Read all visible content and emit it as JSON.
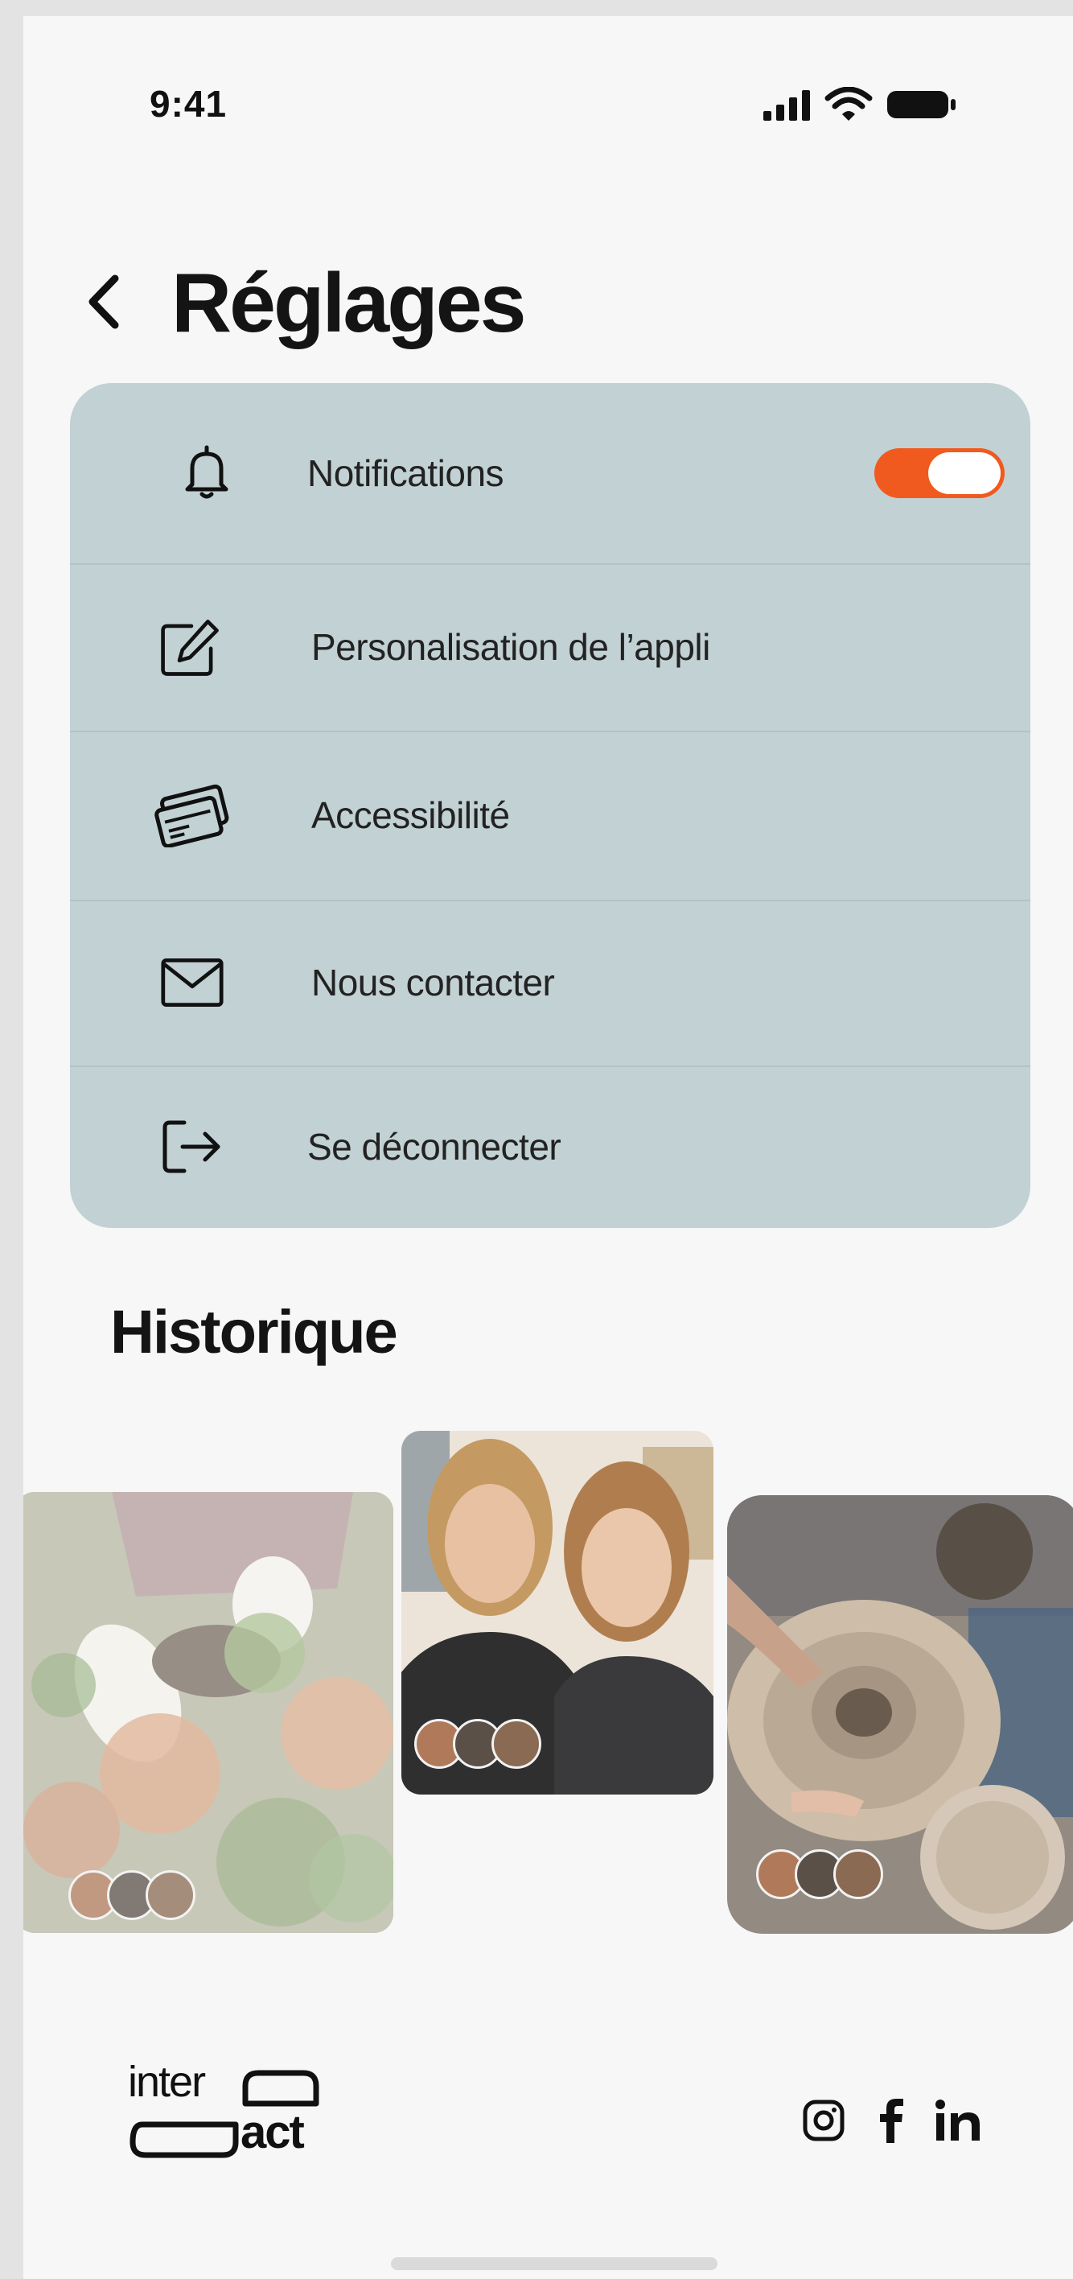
{
  "status_bar": {
    "time": "9:41"
  },
  "header": {
    "title": "Réglages",
    "back_icon": "chevron-left-icon"
  },
  "settings": {
    "items": [
      {
        "label": "Notifications",
        "icon": "bell-icon",
        "toggle_on": true
      },
      {
        "label": "Personalisation de l’appli",
        "icon": "edit-icon"
      },
      {
        "label": "Accessibilité",
        "icon": "cards-icon"
      },
      {
        "label": "Nous contacter",
        "icon": "mail-icon"
      },
      {
        "label": "Se déconnecter",
        "icon": "logout-icon"
      }
    ]
  },
  "history": {
    "title": "Historique",
    "cards": [
      {
        "subject": "gardening-photo"
      },
      {
        "subject": "two-women-photo"
      },
      {
        "subject": "pottery-photo"
      }
    ]
  },
  "footer": {
    "logo_top": "inter",
    "logo_bottom": "act",
    "socials": [
      "instagram-icon",
      "facebook-icon",
      "linkedin-icon"
    ]
  },
  "colors": {
    "card_bg": "#c2d1d3",
    "toggle_on": "#f05a1e",
    "background": "#f7f7f7"
  }
}
